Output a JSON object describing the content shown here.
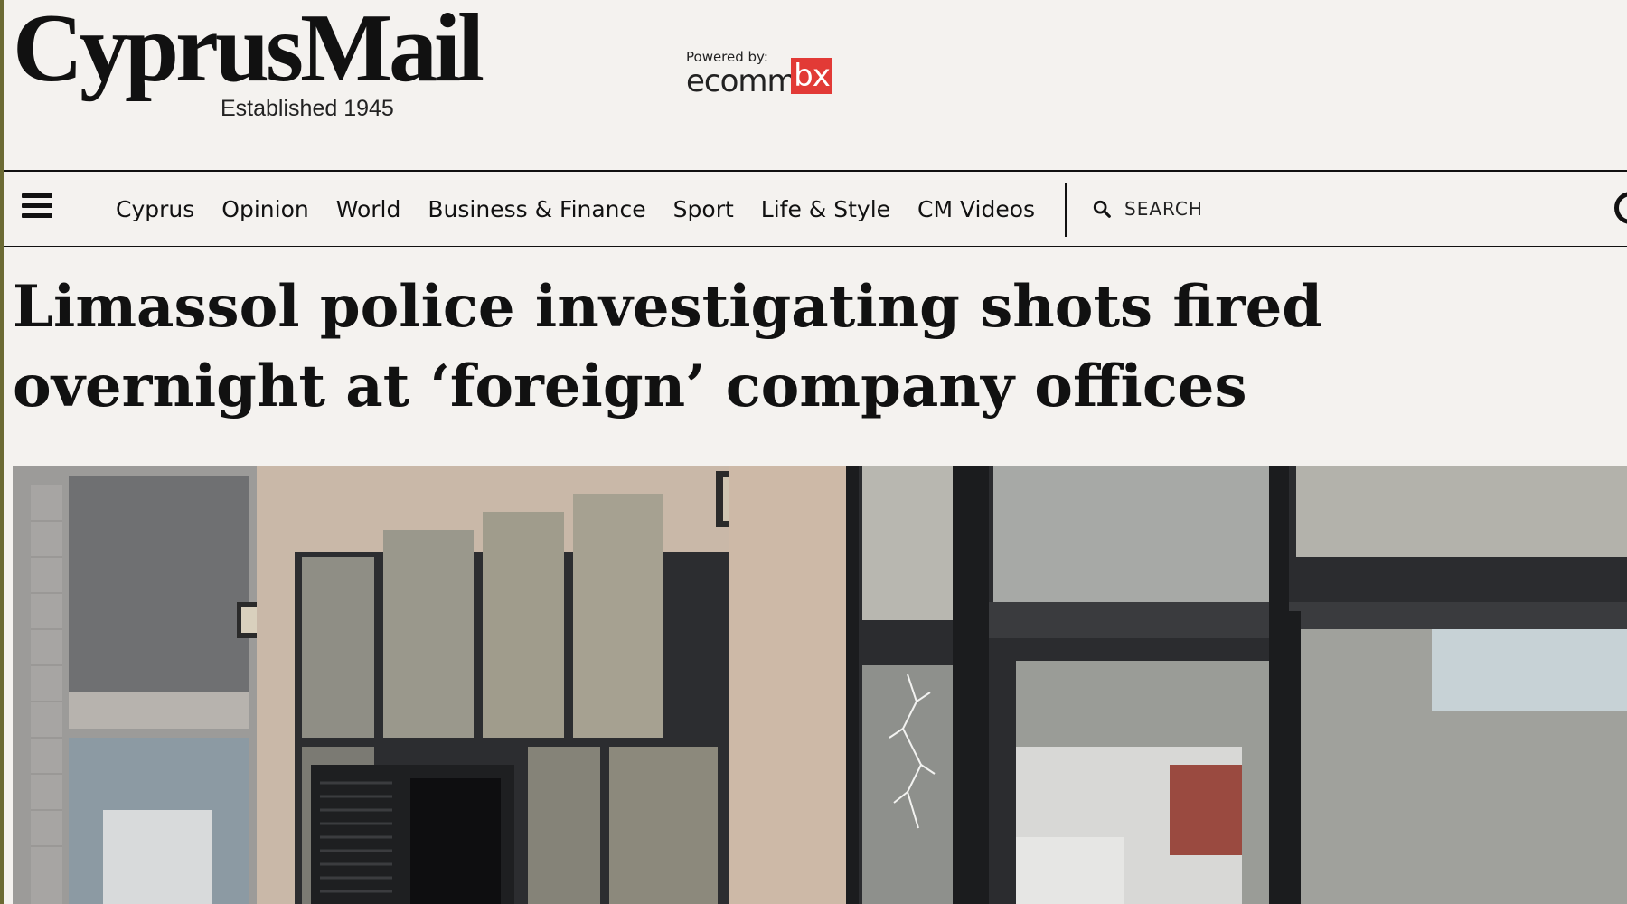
{
  "site": {
    "logo_text": "CyprusMail",
    "established": "Established 1945",
    "sponsor": {
      "label": "Powered by:",
      "brand": "ecomm",
      "brand_box": "bx",
      "brand_box_color": "#e23a36"
    }
  },
  "nav": {
    "menu_icon": "hamburger-icon",
    "items": [
      {
        "label": "Cyprus"
      },
      {
        "label": "Opinion"
      },
      {
        "label": "World"
      },
      {
        "label": "Business & Finance"
      },
      {
        "label": "Sport"
      },
      {
        "label": "Life & Style"
      },
      {
        "label": "CM Videos"
      }
    ],
    "search": {
      "placeholder": "SEARCH",
      "icon": "search-icon"
    }
  },
  "article": {
    "headline": "Limassol police investigating shots fired overnight at ‘foreign’ company offices",
    "image": {
      "subject": "building-facade-with-damaged-glass"
    }
  },
  "colors": {
    "background": "#f4f2ef",
    "text": "#111111",
    "accent": "#e23a36"
  }
}
